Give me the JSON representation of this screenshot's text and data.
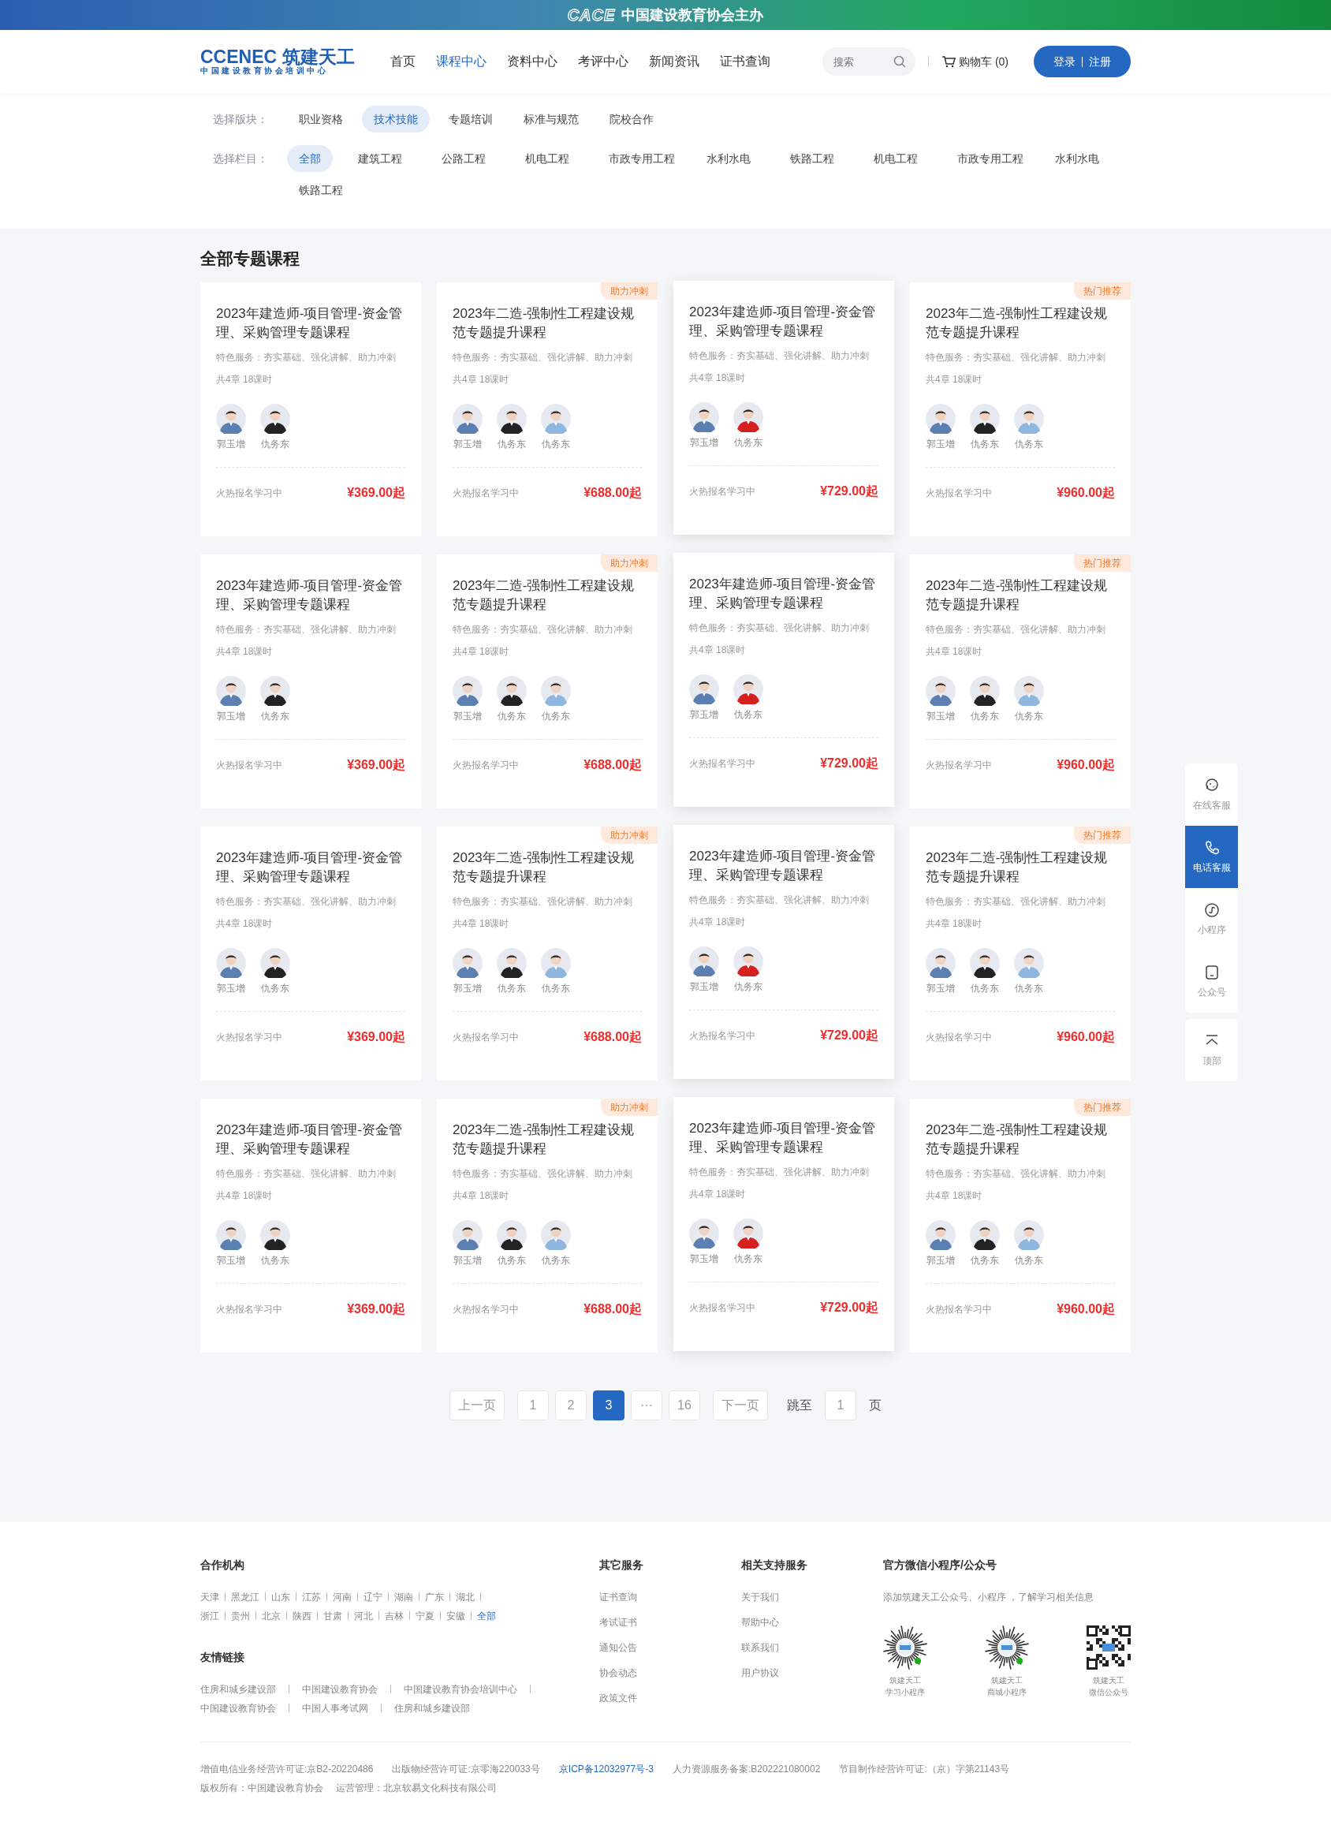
{
  "banner": {
    "logo": "CACE",
    "text": "中国建设教育协会主办"
  },
  "header": {
    "logo": "CCENEC 筑建天工",
    "logo_subtitle": "中国建设教育协会培训中心",
    "nav": [
      {
        "label": "首页",
        "selected": false
      },
      {
        "label": "课程中心",
        "selected": true
      },
      {
        "label": "资料中心",
        "selected": false
      },
      {
        "label": "考评中心",
        "selected": false
      },
      {
        "label": "新闻资讯",
        "selected": false
      },
      {
        "label": "证书查询",
        "selected": false
      }
    ],
    "search": {
      "placeholder": "搜索"
    },
    "cart": "购物车 (0)",
    "login": "登录",
    "register": "注册"
  },
  "filters": [
    {
      "label": "选择版块：",
      "options": [
        {
          "label": "职业资格",
          "selected": false
        },
        {
          "label": "技术技能",
          "selected": true
        },
        {
          "label": "专题培训",
          "selected": false
        },
        {
          "label": "标准与规范",
          "selected": false
        },
        {
          "label": "院校合作",
          "selected": false
        }
      ]
    },
    {
      "label": "选择栏目：",
      "options": [
        {
          "label": "全部",
          "selected": true
        },
        {
          "label": "建筑工程",
          "selected": false
        },
        {
          "label": "公路工程",
          "selected": false
        },
        {
          "label": "机电工程",
          "selected": false
        },
        {
          "label": "市政专用工程",
          "selected": false
        },
        {
          "label": "水利水电",
          "selected": false
        },
        {
          "label": "铁路工程",
          "selected": false
        },
        {
          "label": "机电工程",
          "selected": false
        },
        {
          "label": "市政专用工程",
          "selected": false
        },
        {
          "label": "水利水电",
          "selected": false
        },
        {
          "label": "铁路工程",
          "selected": false
        }
      ]
    }
  ],
  "section_title": "全部专题课程",
  "courses": [
    {
      "title": "2023年建造师-项目管理-资金管理、采购管理专题课程",
      "service": "特色服务：夯实基础、强化讲解、助力冲刺",
      "chapters": "共4章 18课时",
      "teachers": [
        "郭玉增",
        "仇务东"
      ],
      "status": "火热报名学习中",
      "price": "¥369.00",
      "unit": "起",
      "raised": false
    },
    {
      "title": "2023年二造-强制性工程建设规范专题提升课程",
      "tag": "助力冲刺",
      "service": "特色服务：夯实基础、强化讲解、助力冲刺",
      "chapters": "共4章 18课时",
      "teachers": [
        "郭玉增",
        "仇务东",
        "仇务东"
      ],
      "status": "火热报名学习中",
      "price": "¥688.00",
      "unit": "起",
      "raised": false
    },
    {
      "title": "2023年建造师-项目管理-资金管理、采购管理专题课程",
      "service": "特色服务：夯实基础、强化讲解、助力冲刺",
      "chapters": "共4章 18课时",
      "teachers": [
        "郭玉增",
        "仇务东"
      ],
      "status": "火热报名学习中",
      "price": "¥729.00",
      "unit": "起",
      "raised": true
    },
    {
      "title": "2023年二造-强制性工程建设规范专题提升课程",
      "tag": "热门推荐",
      "service": "特色服务：夯实基础、强化讲解、助力冲刺",
      "chapters": "共4章 18课时",
      "teachers": [
        "郭玉增",
        "仇务东",
        "仇务东"
      ],
      "status": "火热报名学习中",
      "price": "¥960.00",
      "unit": "起",
      "raised": false
    },
    {
      "title": "2023年建造师-项目管理-资金管理、采购管理专题课程",
      "service": "特色服务：夯实基础、强化讲解、助力冲刺",
      "chapters": "共4章 18课时",
      "teachers": [
        "郭玉增",
        "仇务东"
      ],
      "status": "火热报名学习中",
      "price": "¥369.00",
      "unit": "起",
      "raised": false
    },
    {
      "title": "2023年二造-强制性工程建设规范专题提升课程",
      "tag": "助力冲刺",
      "service": "特色服务：夯实基础、强化讲解、助力冲刺",
      "chapters": "共4章 18课时",
      "teachers": [
        "郭玉增",
        "仇务东",
        "仇务东"
      ],
      "status": "火热报名学习中",
      "price": "¥688.00",
      "unit": "起",
      "raised": false
    },
    {
      "title": "2023年建造师-项目管理-资金管理、采购管理专题课程",
      "service": "特色服务：夯实基础、强化讲解、助力冲刺",
      "chapters": "共4章 18课时",
      "teachers": [
        "郭玉增",
        "仇务东"
      ],
      "status": "火热报名学习中",
      "price": "¥729.00",
      "unit": "起",
      "raised": true
    },
    {
      "title": "2023年二造-强制性工程建设规范专题提升课程",
      "tag": "热门推荐",
      "service": "特色服务：夯实基础、强化讲解、助力冲刺",
      "chapters": "共4章 18课时",
      "teachers": [
        "郭玉增",
        "仇务东",
        "仇务东"
      ],
      "status": "火热报名学习中",
      "price": "¥960.00",
      "unit": "起",
      "raised": false
    },
    {
      "title": "2023年建造师-项目管理-资金管理、采购管理专题课程",
      "service": "特色服务：夯实基础、强化讲解、助力冲刺",
      "chapters": "共4章 18课时",
      "teachers": [
        "郭玉增",
        "仇务东"
      ],
      "status": "火热报名学习中",
      "price": "¥369.00",
      "unit": "起",
      "raised": false
    },
    {
      "title": "2023年二造-强制性工程建设规范专题提升课程",
      "tag": "助力冲刺",
      "service": "特色服务：夯实基础、强化讲解、助力冲刺",
      "chapters": "共4章 18课时",
      "teachers": [
        "郭玉增",
        "仇务东",
        "仇务东"
      ],
      "status": "火热报名学习中",
      "price": "¥688.00",
      "unit": "起",
      "raised": false
    },
    {
      "title": "2023年建造师-项目管理-资金管理、采购管理专题课程",
      "service": "特色服务：夯实基础、强化讲解、助力冲刺",
      "chapters": "共4章 18课时",
      "teachers": [
        "郭玉增",
        "仇务东"
      ],
      "status": "火热报名学习中",
      "price": "¥729.00",
      "unit": "起",
      "raised": true
    },
    {
      "title": "2023年二造-强制性工程建设规范专题提升课程",
      "tag": "热门推荐",
      "service": "特色服务：夯实基础、强化讲解、助力冲刺",
      "chapters": "共4章 18课时",
      "teachers": [
        "郭玉增",
        "仇务东",
        "仇务东"
      ],
      "status": "火热报名学习中",
      "price": "¥960.00",
      "unit": "起",
      "raised": false
    },
    {
      "title": "2023年建造师-项目管理-资金管理、采购管理专题课程",
      "service": "特色服务：夯实基础、强化讲解、助力冲刺",
      "chapters": "共4章 18课时",
      "teachers": [
        "郭玉增",
        "仇务东"
      ],
      "status": "火热报名学习中",
      "price": "¥369.00",
      "unit": "起",
      "raised": false
    },
    {
      "title": "2023年二造-强制性工程建设规范专题提升课程",
      "tag": "助力冲刺",
      "service": "特色服务：夯实基础、强化讲解、助力冲刺",
      "chapters": "共4章 18课时",
      "teachers": [
        "郭玉增",
        "仇务东",
        "仇务东"
      ],
      "status": "火热报名学习中",
      "price": "¥688.00",
      "unit": "起",
      "raised": false
    },
    {
      "title": "2023年建造师-项目管理-资金管理、采购管理专题课程",
      "service": "特色服务：夯实基础、强化讲解、助力冲刺",
      "chapters": "共4章 18课时",
      "teachers": [
        "郭玉增",
        "仇务东"
      ],
      "status": "火热报名学习中",
      "price": "¥729.00",
      "unit": "起",
      "raised": true
    },
    {
      "title": "2023年二造-强制性工程建设规范专题提升课程",
      "tag": "热门推荐",
      "service": "特色服务：夯实基础、强化讲解、助力冲刺",
      "chapters": "共4章 18课时",
      "teachers": [
        "郭玉增",
        "仇务东",
        "仇务东"
      ],
      "status": "火热报名学习中",
      "price": "¥960.00",
      "unit": "起",
      "raised": false
    }
  ],
  "pagination": {
    "prev": "上一页",
    "pages": [
      {
        "label": "1",
        "selected": false
      },
      {
        "label": "2",
        "selected": false
      },
      {
        "label": "3",
        "selected": true
      },
      {
        "label": "···",
        "selected": false
      },
      {
        "label": "16",
        "selected": false
      }
    ],
    "next": "下一页",
    "jump_label": "跳至",
    "jump_value": "1",
    "jump_suffix": "页"
  },
  "side_tools": [
    {
      "kind": "chat",
      "label": "在线客服",
      "selected": false
    },
    {
      "kind": "phone",
      "label": "电话客服",
      "selected": true
    },
    {
      "kind": "miniprogram",
      "label": "小程序",
      "selected": false
    },
    {
      "kind": "account",
      "label": "公众号",
      "selected": false
    },
    {
      "kind": "top",
      "label": "顶部",
      "selected": false
    }
  ],
  "footer": {
    "partners": {
      "title": "合作机构",
      "items": [
        {
          "label": "天津",
          "selected": false
        },
        {
          "label": "黑龙江",
          "selected": false
        },
        {
          "label": "山东",
          "selected": false
        },
        {
          "label": "江苏",
          "selected": false
        },
        {
          "label": "河南",
          "selected": false
        },
        {
          "label": "辽宁",
          "selected": false
        },
        {
          "label": "湖南",
          "selected": false
        },
        {
          "label": "广东",
          "selected": false
        },
        {
          "label": "湖北",
          "selected": false
        },
        {
          "label": "浙江",
          "selected": false
        },
        {
          "label": "贵州",
          "selected": false
        },
        {
          "label": "北京",
          "selected": false
        },
        {
          "label": "陕西",
          "selected": false
        },
        {
          "label": "甘肃",
          "selected": false
        },
        {
          "label": "河北",
          "selected": false
        },
        {
          "label": "吉林",
          "selected": false
        },
        {
          "label": "宁夏",
          "selected": false
        },
        {
          "label": "安徽",
          "selected": false
        },
        {
          "label": "全部",
          "selected": true
        }
      ]
    },
    "links": {
      "title": "友情链接",
      "items": [
        "住房和城乡建设部",
        "中国建设教育协会",
        "中国建设教育协会培训中心",
        "中国建设教育协会",
        "中国人事考试网",
        "住房和城乡建设部"
      ]
    },
    "columns": [
      {
        "title": "其它服务",
        "items": [
          "证书查询",
          "考试证书",
          "通知公告",
          "协会动态",
          "政策文件"
        ]
      },
      {
        "title": "相关支持服务",
        "items": [
          "关于我们",
          "帮助中心",
          "联系我们",
          "用户协议"
        ]
      }
    ],
    "wechat": {
      "title": "官方微信小程序/公众号",
      "text": "添加筑建天工公众号、小程序 ，了解学习相关信息",
      "codes": [
        {
          "kind": "miniprogram",
          "name": "筑建天工",
          "desc": "学习小程序"
        },
        {
          "kind": "miniprogram",
          "name": "筑建天工",
          "desc": "商城小程序"
        },
        {
          "kind": "qrcode",
          "name": "筑建天工",
          "desc": "微信公众号"
        }
      ]
    },
    "licenses": [
      {
        "kind": "text",
        "text": "增值电信业务经营许可证:京B2-20220486"
      },
      {
        "kind": "text",
        "text": "出版物经营许可证:京零海220033号"
      },
      {
        "kind": "link",
        "text": "京ICP备12032977号-3"
      },
      {
        "kind": "text",
        "text": "人力资源服务备案:B202221080002"
      },
      {
        "kind": "text",
        "text": "节目制作经营许可证:（京）字第21143号"
      }
    ],
    "copyright": "版权所有：中国建设教育协会",
    "operator": "运营管理：北京软易文化科技有限公司"
  }
}
